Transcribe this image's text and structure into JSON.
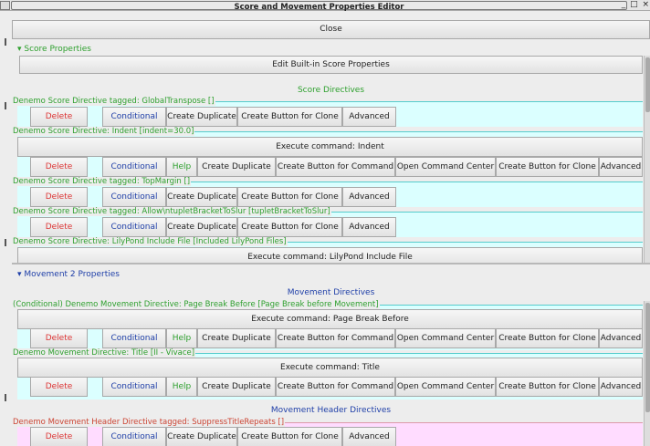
{
  "window": {
    "title": "Score and Movement Properties Editor",
    "controls": "_ □ ×"
  },
  "close_label": "Close",
  "score_panel": {
    "header": "▾ Score Properties",
    "edit_builtin": "Edit Built-in Score Properties",
    "section_title": "Score  Directives",
    "directives": [
      {
        "label": "Denemo Score  Directive tagged: GlobalTranspose []",
        "buttons": [
          "Delete",
          "Conditional",
          "Create Duplicate",
          "Create Button for Clone",
          "Advanced"
        ]
      },
      {
        "label": "Denemo Score  Directive: Indent [indent=30.0]",
        "exec": "Execute command: Indent",
        "buttons": [
          "Delete",
          "Conditional",
          "Help",
          "Create Duplicate",
          "Create Button for Command",
          "Open Command Center",
          "Create Button for Clone",
          "Advanced"
        ]
      },
      {
        "label": "Denemo Score  Directive tagged: TopMargin []",
        "buttons": [
          "Delete",
          "Conditional",
          "Create Duplicate",
          "Create Button for Clone",
          "Advanced"
        ]
      },
      {
        "label": "Denemo Score  Directive tagged: Allow\\ntupletBracketToSlur [tupletBracketToSlur]",
        "buttons": [
          "Delete",
          "Conditional",
          "Create Duplicate",
          "Create Button for Clone",
          "Advanced"
        ]
      },
      {
        "label": "Denemo Score  Directive: LilyPond Include File [Included LilyPond Files]",
        "exec": "Execute command: LilyPond Include File"
      }
    ]
  },
  "movement_panel": {
    "header": "▾ Movement 2 Properties",
    "section_title": "Movement  Directives",
    "directives": [
      {
        "label": "(Conditional) Denemo Movement  Directive: Page Break Before [Page Break before Movement]",
        "exec": "Execute command: Page Break Before",
        "buttons": [
          "Delete",
          "Conditional",
          "Help",
          "Create Duplicate",
          "Create Button for Command",
          "Open Command Center",
          "Create Button for Clone",
          "Advanced"
        ]
      },
      {
        "label": "Denemo Movement  Directive: Title [II - Vivace]",
        "exec": "Execute command: Title",
        "buttons": [
          "Delete",
          "Conditional",
          "Help",
          "Create Duplicate",
          "Create Button for Command",
          "Open Command Center",
          "Create Button for Clone",
          "Advanced"
        ]
      }
    ],
    "header_section_title": "Movement Header  Directives",
    "header_directives": [
      {
        "label": "Denemo Movement Header  Directive tagged: SuppressTitleRepeats []",
        "buttons": [
          "Delete",
          "Conditional",
          "Create Duplicate",
          "Create Button for Clone",
          "Advanced"
        ]
      }
    ]
  }
}
